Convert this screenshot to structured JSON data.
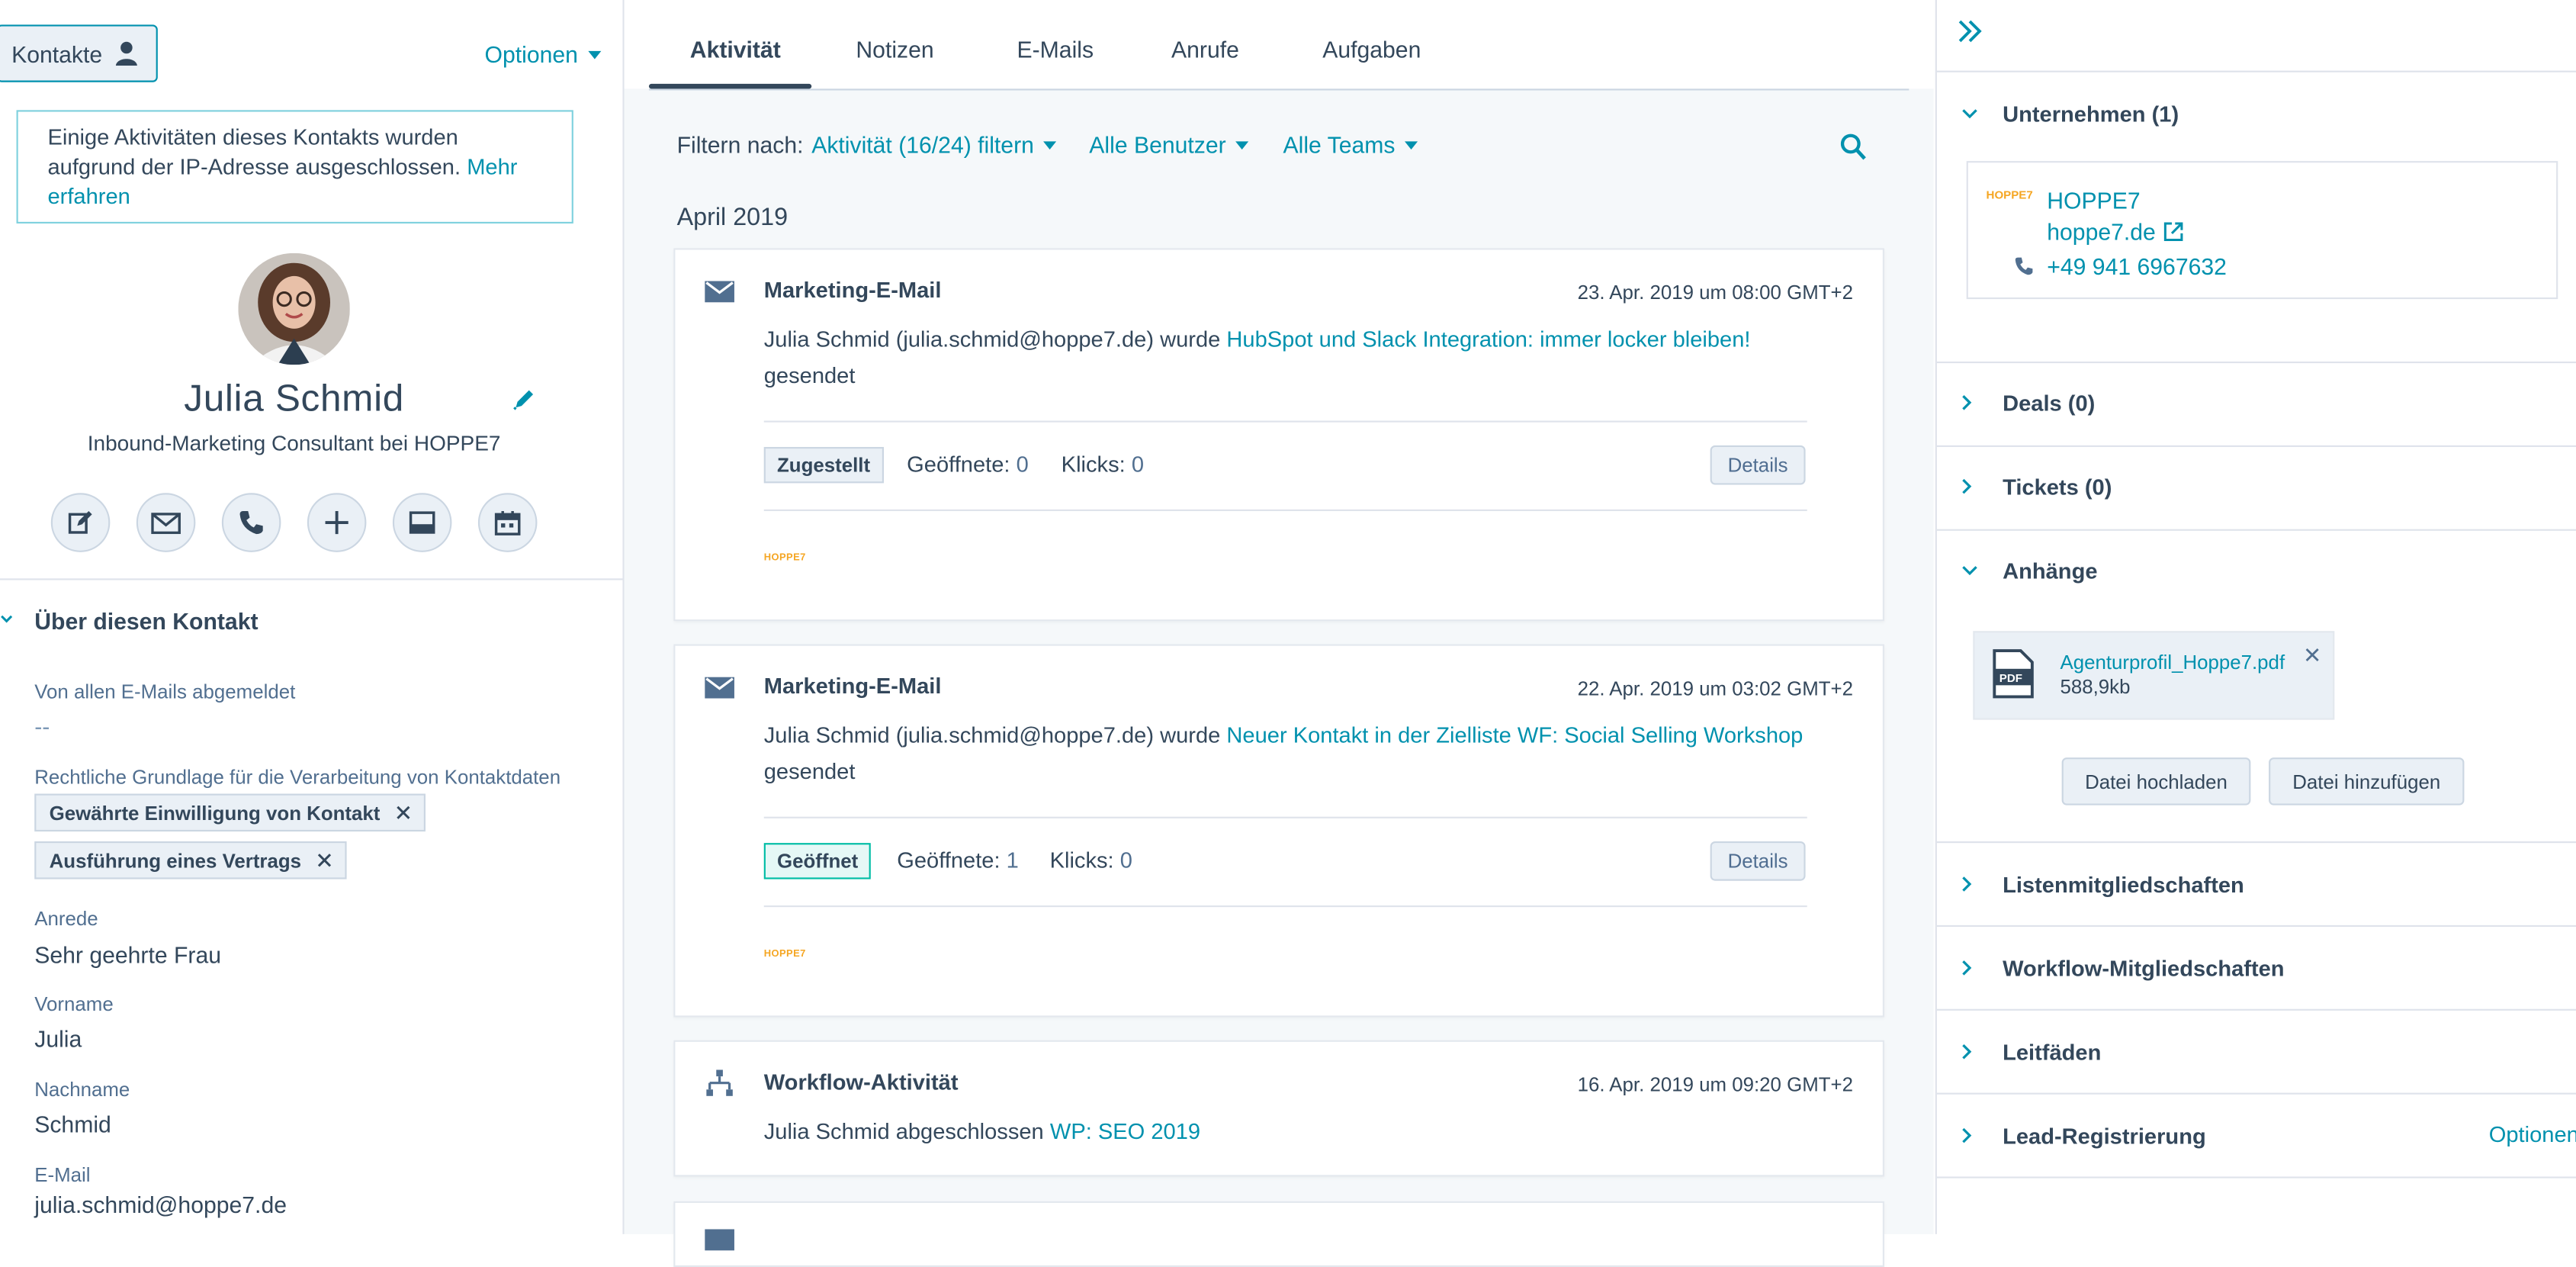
{
  "contact_header": {
    "kontakte_label": "Kontakte",
    "optionen_label": "Optionen"
  },
  "notice": {
    "text": "Einige Aktivitäten dieses Kontakts wurden aufgrund der IP-Adresse ausgeschlossen.",
    "link": "Mehr erfahren"
  },
  "profile": {
    "name": "Julia Schmid",
    "job_title": "Inbound-Marketing Consultant bei HOPPE7"
  },
  "about": {
    "title": "Über diesen Kontakt",
    "props": [
      {
        "label": "Von allen E-Mails abgemeldet",
        "value": "--"
      },
      {
        "label": "Rechtliche Grundlage für die Verarbeitung von Kontaktdaten",
        "tags": [
          "Gewährte Einwilligung von Kontakt",
          "Ausführung eines Vertrags"
        ]
      },
      {
        "label": "Anrede",
        "value": "Sehr geehrte Frau"
      },
      {
        "label": "Vorname",
        "value": "Julia"
      },
      {
        "label": "Nachname",
        "value": "Schmid"
      },
      {
        "label": "E-Mail",
        "value": "julia.schmid@hoppe7.de"
      }
    ]
  },
  "tabs": [
    "Aktivität",
    "Notizen",
    "E-Mails",
    "Anrufe",
    "Aufgaben"
  ],
  "filters": {
    "label": "Filtern nach:",
    "activity": "Aktivität (16/24) filtern",
    "users": "Alle Benutzer",
    "teams": "Alle Teams"
  },
  "timeline": {
    "month": "April 2019",
    "items": [
      {
        "type": "Marketing-E-Mail",
        "date": "23. Apr. 2019 um 08:00 GMT+2",
        "text_pre": "Julia Schmid (julia.schmid@hoppe7.de) wurde",
        "link": "HubSpot und Slack Integration: immer locker bleiben!",
        "text_post": "gesendet",
        "status": "Zugestellt",
        "opens_label": "Geöffnete:",
        "opens": "0",
        "clicks_label": "Klicks:",
        "clicks": "0",
        "details": "Details",
        "brand": "HOPPE7"
      },
      {
        "type": "Marketing-E-Mail",
        "date": "22. Apr. 2019 um 03:02 GMT+2",
        "text_pre": "Julia Schmid (julia.schmid@hoppe7.de) wurde",
        "link": "Neuer Kontakt in der Zielliste WF: Social Selling Workshop",
        "text_post": "gesendet",
        "status": "Geöffnet",
        "opens_label": "Geöffnete:",
        "opens": "1",
        "clicks_label": "Klicks:",
        "clicks": "0",
        "details": "Details",
        "brand": "HOPPE7"
      },
      {
        "type": "Workflow-Aktivität",
        "date": "16. Apr. 2019 um 09:20 GMT+2",
        "text_pre": "Julia Schmid abgeschlossen",
        "link": "WP: SEO 2019"
      }
    ]
  },
  "sidebar": {
    "company": {
      "title": "Unternehmen (1)",
      "name": "HOPPE7",
      "domain": "hoppe7.de",
      "phone": "+49 941 6967632",
      "logo": "HOPPE7"
    },
    "deals": "Deals (0)",
    "tickets": "Tickets (0)",
    "attachments": {
      "title": "Anhänge",
      "file_name": "Agenturprofil_Hoppe7.pdf",
      "file_size": "588,9kb",
      "upload": "Datei hochladen",
      "add": "Datei hinzufügen",
      "pdf_badge": "PDF"
    },
    "lists": "Listenmitgliedschaften",
    "workflows": "Workflow-Mitgliedschaften",
    "playbooks": "Leitfäden",
    "lead_reg": "Lead-Registrierung",
    "lead_options": "Optionen"
  },
  "colors": {
    "link": "#0091ae",
    "text": "#33475b",
    "border": "#cbd6e2",
    "success": "#00bda5"
  }
}
